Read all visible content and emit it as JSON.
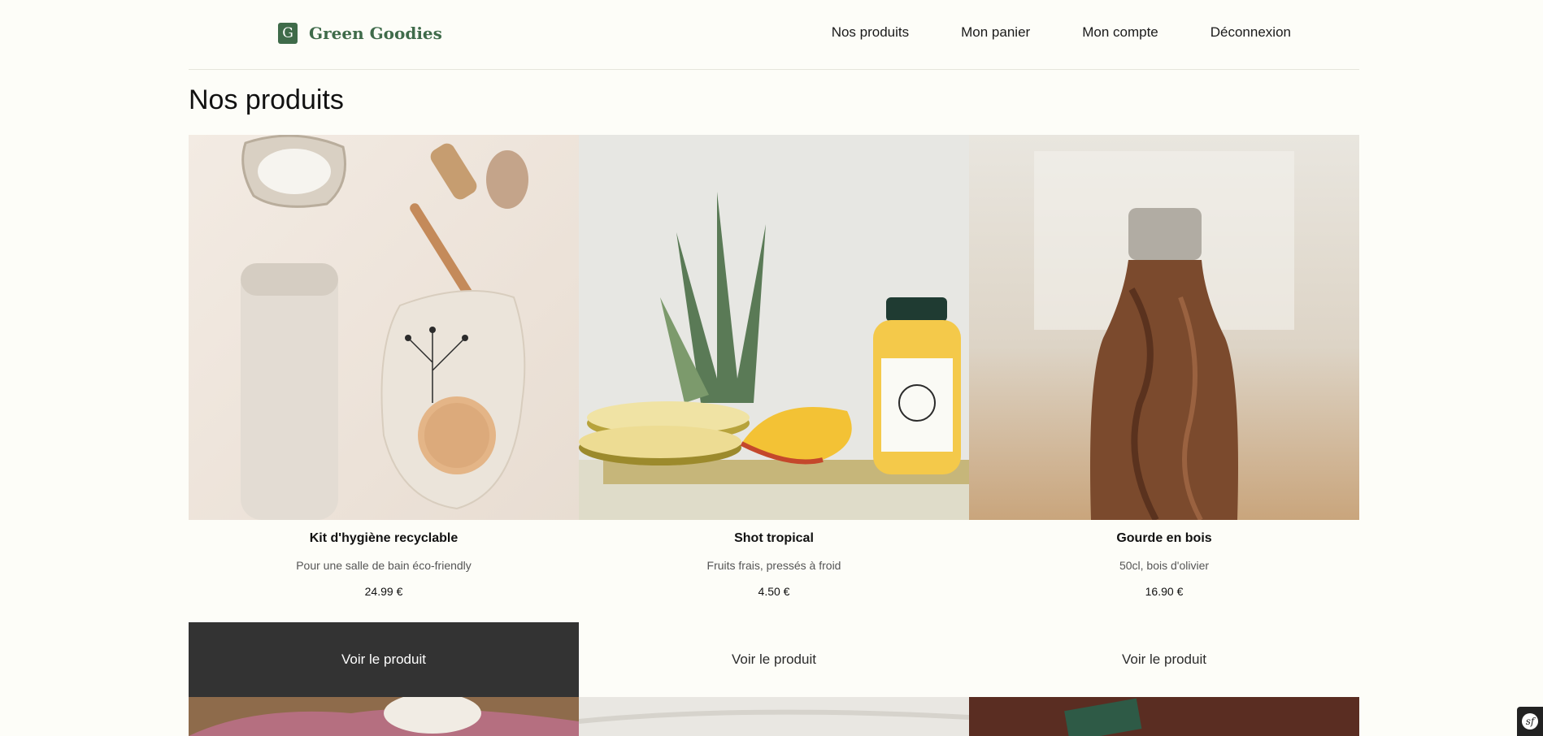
{
  "header": {
    "brand_name": "Green Goodies",
    "brand_mark": "G",
    "nav": [
      {
        "label": "Nos produits"
      },
      {
        "label": "Mon panier"
      },
      {
        "label": "Mon compte"
      },
      {
        "label": "Déconnexion"
      }
    ]
  },
  "page": {
    "title": "Nos produits"
  },
  "products": [
    {
      "name": "Kit d'hygiène recyclable",
      "description": "Pour une salle de bain éco-friendly",
      "price": "24.99 €",
      "button": "Voir le produit"
    },
    {
      "name": "Shot tropical",
      "description": "Fruits frais, pressés à froid",
      "price": "4.50 €",
      "button": "Voir le produit"
    },
    {
      "name": "Gourde en bois",
      "description": "50cl, bois d'olivier",
      "price": "16.90 €",
      "button": "Voir le produit"
    }
  ],
  "colors": {
    "background": "#fdfdf8",
    "brand": "#3f6b4a",
    "button_active": "#333333"
  },
  "icons": {
    "toolbar": "symfony-icon"
  }
}
